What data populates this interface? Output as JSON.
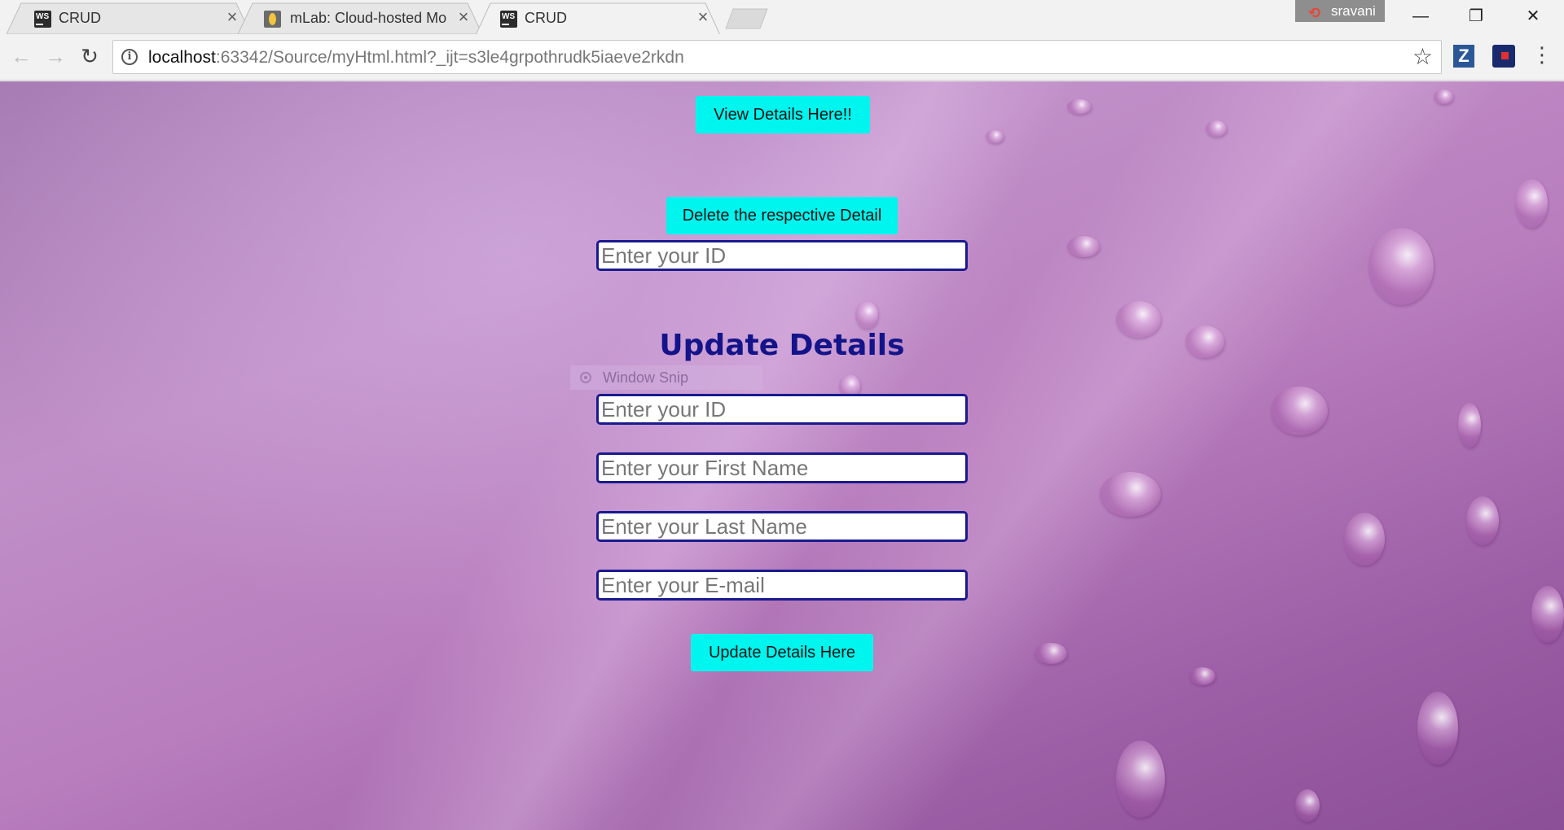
{
  "browser": {
    "tabs": [
      {
        "title": "CRUD",
        "favicon": "webstorm-icon",
        "active": false
      },
      {
        "title": "mLab: Cloud-hosted MongoDB",
        "favicon": "mlab-icon",
        "active": false
      },
      {
        "title": "CRUD",
        "favicon": "webstorm-icon",
        "active": true
      }
    ],
    "profile_name": "sravani",
    "address": {
      "host": "localhost",
      "rest": ":63342/Source/myHtml.html?_ijt=s3le4grpothrudk5iaeve2rkdn"
    }
  },
  "page": {
    "view_button": "View Details Here!!",
    "delete_button": "Delete the respective Detail",
    "delete_id_placeholder": "Enter your ID",
    "update_heading": "Update Details",
    "update_fields": {
      "id_placeholder": "Enter your ID",
      "first_name_placeholder": "Enter your First Name",
      "last_name_placeholder": "Enter your Last Name",
      "email_placeholder": "Enter your E-mail"
    },
    "update_button": "Update Details Here"
  },
  "overlay": {
    "window_snip_label": "Window Snip"
  },
  "colors": {
    "button_bg": "#00f5ef",
    "heading": "#14148a",
    "field_border": "#1a1a8e"
  }
}
